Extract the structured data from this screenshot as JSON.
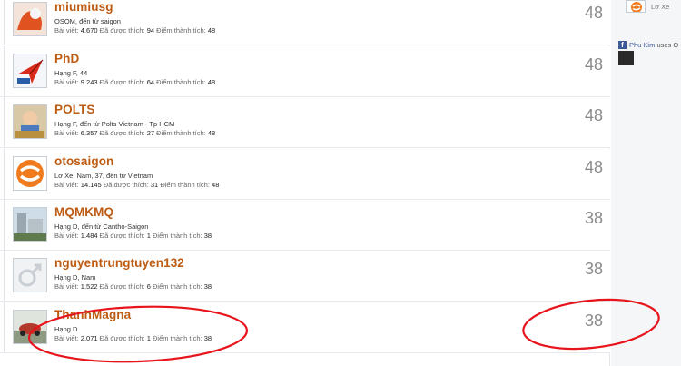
{
  "members": [
    {
      "name": "miumiusg",
      "title": "OSOM, đến từ saigon",
      "posts_label": "Bài viết:",
      "posts": "4.670",
      "likes_label": "Đã được thích:",
      "likes": "94",
      "points_label": "Điểm thành tích:",
      "points": "48",
      "score": "48",
      "avatar_icon": "abstract-orange-icon"
    },
    {
      "name": "PhD",
      "title": "Hạng F, 44",
      "posts_label": "Bài viết:",
      "posts": "9.243",
      "likes_label": "Đã được thích:",
      "likes": "64",
      "points_label": "Điểm thành tích:",
      "points": "48",
      "score": "48",
      "avatar_icon": "paper-plane-icon"
    },
    {
      "name": "POLTS",
      "title": "Hạng F, đến từ Polts Vietnam - Tp HCM",
      "posts_label": "Bài viết:",
      "posts": "6.357",
      "likes_label": "Đã được thích:",
      "likes": "27",
      "points_label": "Điểm thành tích:",
      "points": "48",
      "score": "48",
      "avatar_icon": "child-photo-icon"
    },
    {
      "name": "otosaigon",
      "title": "Lơ Xe, Nam, 37, đến từ Vietnam",
      "posts_label": "Bài viết:",
      "posts": "14.145",
      "likes_label": "Đã được thích:",
      "likes": "31",
      "points_label": "Điểm thành tích:",
      "points": "48",
      "score": "48",
      "avatar_icon": "otosaigon-logo-icon"
    },
    {
      "name": "MQMKMQ",
      "title": "Hạng D, đến từ Cantho-Saigon",
      "posts_label": "Bài viết:",
      "posts": "1.484",
      "likes_label": "Đã được thích:",
      "likes": "1",
      "points_label": "Điểm thành tích:",
      "points": "38",
      "score": "38",
      "avatar_icon": "building-photo-icon"
    },
    {
      "name": "nguyentrungtuyen132",
      "title": "Hạng D, Nam",
      "posts_label": "Bài viết:",
      "posts": "1.522",
      "likes_label": "Đã được thích:",
      "likes": "6",
      "points_label": "Điểm thành tích:",
      "points": "38",
      "score": "38",
      "avatar_icon": "male-symbol-icon"
    },
    {
      "name": "ThanhMagna",
      "title": "Hạng D",
      "posts_label": "Bài viết:",
      "posts": "2.071",
      "likes_label": "Đã được thích:",
      "likes": "1",
      "points_label": "Điểm thành tích:",
      "points": "38",
      "score": "38",
      "avatar_icon": "car-photo-icon"
    }
  ],
  "sidebar": {
    "profile_name": "Lơ Xe",
    "fb_user": "Phu Kim",
    "fb_rest": " uses O"
  },
  "colors": {
    "username": "#bd5b12",
    "annotation": "#e8141c",
    "score": "#8a8a8a"
  }
}
